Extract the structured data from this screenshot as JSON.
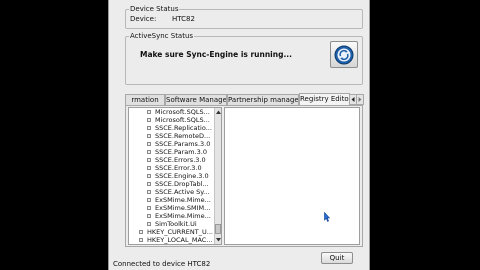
{
  "device_status": {
    "group_label": "Device Status",
    "device_label": "Device:",
    "device_value": "HTC82"
  },
  "activesync": {
    "group_label": "ActiveSync Status",
    "message": "Make sure Sync-Engine is running...",
    "icon": "activesync-icon"
  },
  "tabs": [
    {
      "label": "rmation"
    },
    {
      "label": "Software Manager"
    },
    {
      "label": "Partnership manager"
    },
    {
      "label": "Registry Editor",
      "active": true
    }
  ],
  "tree": {
    "items": [
      "Microsoft.SQLS...",
      "Microsoft.SQLS...",
      "SSCE.Replicatio...",
      "SSCE.RemoteD...",
      "SSCE.Params.3.0",
      "SSCE.Param.3.0",
      "SSCE.Errors.3.0",
      "SSCE.Error.3.0",
      "SSCE.Engine.3.0",
      "SSCE.DropTabl...",
      "SSCE.Active Sy...",
      "ExSMime.Mime...",
      "ExSMime.SMIM...",
      "ExSMime.Mime...",
      "SimToolkit.Ui"
    ],
    "roots": [
      "HKEY_CURRENT_U...",
      "HKEY_LOCAL_MAC..."
    ]
  },
  "statusbar": {
    "text": "Connected to device HTC82"
  },
  "buttons": {
    "quit": "Quit"
  }
}
